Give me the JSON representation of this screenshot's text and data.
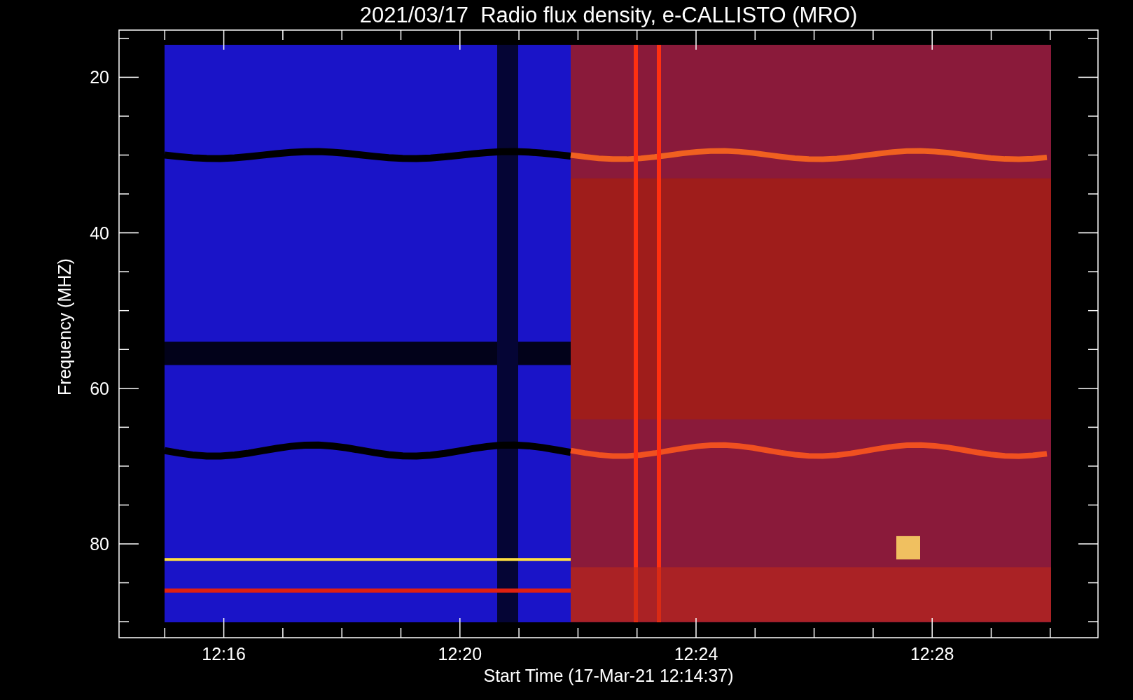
{
  "title": "2021/03/17  Radio flux density, e-CALLISTO (MRO)",
  "y_axis": {
    "label": "Frequency (MHZ)",
    "ticks": [
      "20",
      "40",
      "60",
      "80"
    ]
  },
  "x_axis": {
    "label": "Start Time (17-Mar-21 12:14:37)",
    "ticks": [
      "12:16",
      "12:20",
      "12:24",
      "12:28"
    ]
  }
}
